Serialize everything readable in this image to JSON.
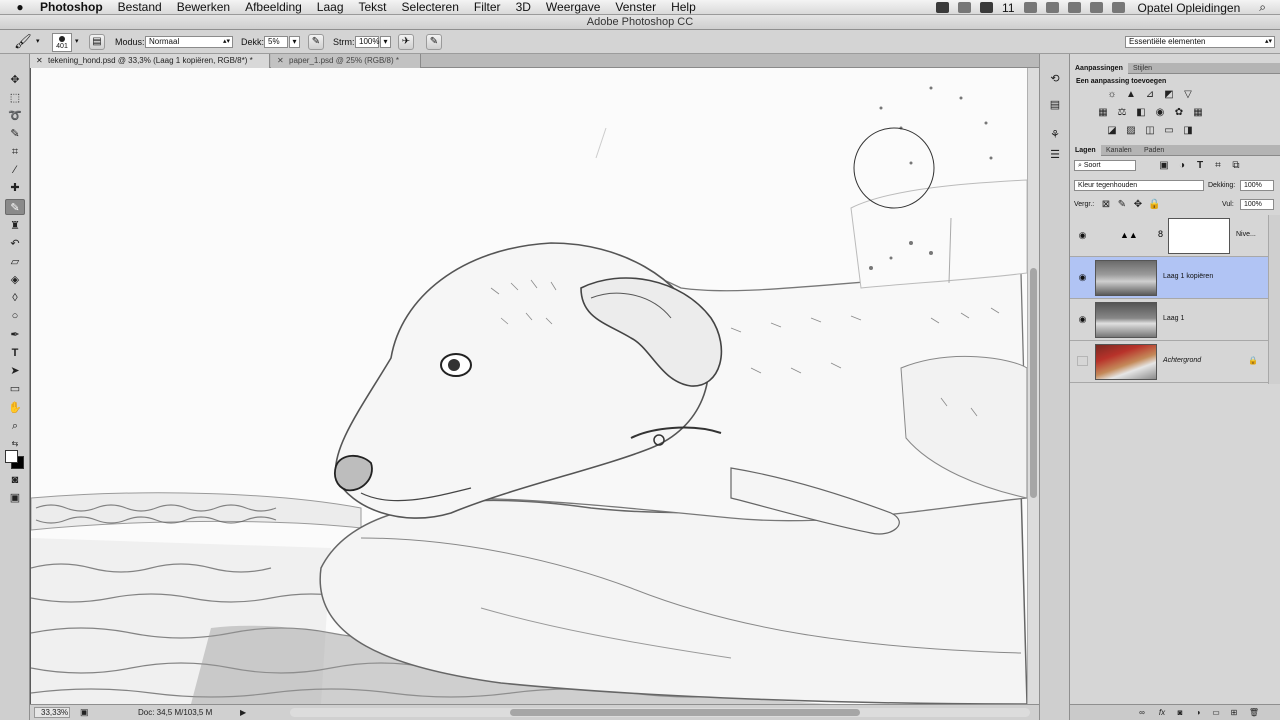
{
  "menubar": {
    "apple_icon": "apple-icon",
    "app_name": "Photoshop",
    "menus": [
      "Bestand",
      "Bewerken",
      "Afbeelding",
      "Laag",
      "Tekst",
      "Selecteren",
      "Filter",
      "3D",
      "Weergave",
      "Venster",
      "Help"
    ],
    "status_number": "11",
    "user_name": "Opatel Opleidingen"
  },
  "window": {
    "title": "Adobe Photoshop CC"
  },
  "options": {
    "brush_size": "401",
    "mode_label": "Modus:",
    "mode_value": "Normaal",
    "opacity_label": "Dekk:",
    "opacity_value": "5%",
    "flow_label": "Strm:",
    "flow_value": "100%",
    "workspace": "Essentiële elementen"
  },
  "document": {
    "tabs": [
      {
        "label": "tekening_hond.psd @ 33,3% (Laag 1 kopiëren, RGB/8*) *",
        "active": true
      },
      {
        "label": "paper_1.psd @ 25% (RGB/8) *",
        "active": false
      }
    ],
    "zoom": "33,33%",
    "doc_size": "Doc: 34,5 M/103,5 M"
  },
  "adjustments": {
    "tabs": [
      "Aanpassingen",
      "Stijlen"
    ],
    "title": "Een aanpassing toevoegen"
  },
  "layers": {
    "tabs": [
      "Lagen",
      "Kanalen",
      "Paden"
    ],
    "filter_value": "Soort",
    "blend_mode": "Kleur tegenhouden",
    "opacity_label": "Dekking:",
    "opacity_value": "100%",
    "lock_label": "Vergr.:",
    "fill_label": "Vul:",
    "fill_value": "100%",
    "items": [
      {
        "name": "Nive...",
        "visible": true,
        "selected": false
      },
      {
        "name": "Laag 1 kopiëren",
        "visible": true,
        "selected": true
      },
      {
        "name": "Laag 1",
        "visible": true,
        "selected": false
      },
      {
        "name": "Achtergrond",
        "visible": false,
        "selected": false,
        "locked": true
      }
    ]
  },
  "colors": {
    "selection": "#b1c4f4",
    "panel_bg": "#d6d6d6",
    "accent_red": "#b8322a"
  }
}
